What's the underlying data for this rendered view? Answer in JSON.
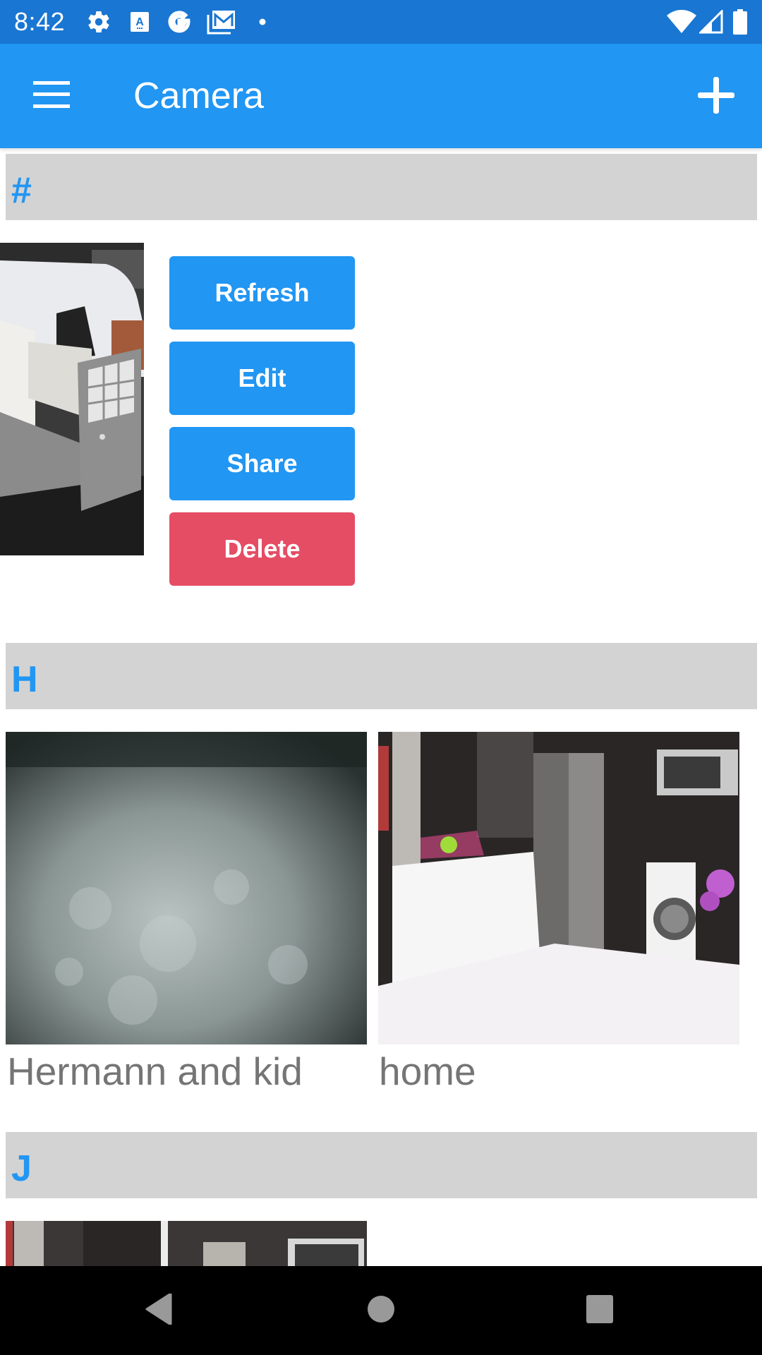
{
  "status_bar": {
    "time": "8:42",
    "left_icons": [
      "settings-icon",
      "text-a-icon",
      "google-g-icon",
      "gmail-icon",
      "notification-dot-icon"
    ],
    "right_icons": [
      "wifi-icon",
      "cellular-signal-icon",
      "battery-icon"
    ]
  },
  "app_bar": {
    "title": "Camera",
    "menu_icon": "hamburger-menu-icon",
    "add_icon": "plus-icon"
  },
  "colors": {
    "status_bar": "#1976D2",
    "primary": "#2196F3",
    "danger": "#E54D64",
    "section_header_bg": "#D3D3D3",
    "label_text": "#757575"
  },
  "sections": [
    {
      "letter": "#",
      "cameras": [
        {
          "name": "",
          "thumbnail": "van-driveway-gate"
        }
      ],
      "actions": [
        {
          "label": "Refresh",
          "style": "primary"
        },
        {
          "label": "Edit",
          "style": "primary"
        },
        {
          "label": "Share",
          "style": "primary"
        },
        {
          "label": "Delete",
          "style": "danger"
        }
      ]
    },
    {
      "letter": "H",
      "cameras": [
        {
          "name": "Hermann and kid",
          "thumbnail": "night-vision-ground"
        },
        {
          "name": "home",
          "thumbnail": "kitchen-interior"
        }
      ]
    },
    {
      "letter": "J",
      "cameras": [
        {
          "name": "",
          "thumbnail": "kitchen-interior-partial"
        }
      ]
    }
  ],
  "nav_bar": {
    "back": "back-triangle-icon",
    "home": "home-circle-icon",
    "recents": "recents-square-icon"
  }
}
